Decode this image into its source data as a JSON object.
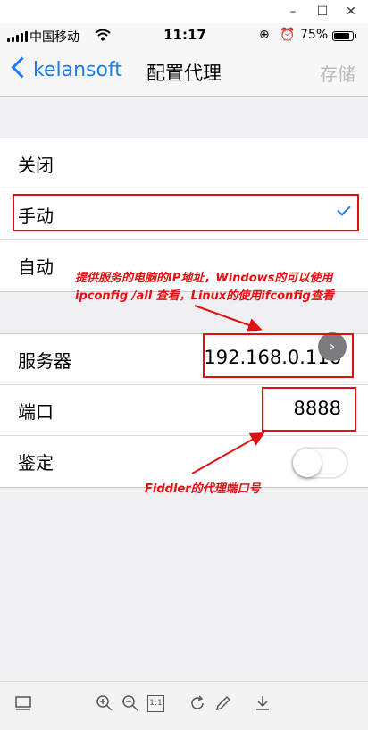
{
  "window": {
    "minimize": "–",
    "maximize": "☐",
    "close": "✕"
  },
  "status_bar": {
    "carrier": "中国移动",
    "time": "11:17",
    "battery": "75%"
  },
  "nav": {
    "back_label": "kelansoft",
    "title": "配置代理",
    "save_label": "存储"
  },
  "proxy_modes": [
    {
      "label": "关闭",
      "selected": false
    },
    {
      "label": "手动",
      "selected": true
    },
    {
      "label": "自动",
      "selected": false
    }
  ],
  "fields": {
    "server": {
      "label": "服务器",
      "value": "192.168.0.116"
    },
    "port": {
      "label": "端口",
      "value": "8888"
    },
    "auth": {
      "label": "鉴定",
      "enabled": false
    }
  },
  "annotations": {
    "ip_note_line1": "提供服务的电脑的IP地址，Windows的可以使用",
    "ip_note_line2": "ipconfig /all 查看，Linux的使用ifconfig查看",
    "port_note": "Fiddler的代理端口号"
  },
  "toolbar_icons": [
    "panel-icon",
    "zoom-in-icon",
    "zoom-out-icon",
    "actual-size-icon",
    "rotate-icon",
    "edit-icon",
    "download-icon"
  ],
  "toolbar_glyphs": {
    "actual_size": "1:1"
  },
  "colors": {
    "accent": "#1a7cf4",
    "annotation": "#e01010"
  }
}
